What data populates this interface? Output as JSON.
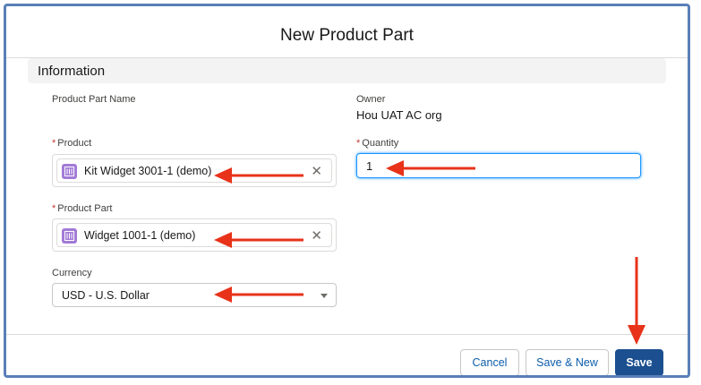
{
  "modal": {
    "title": "New Product Part"
  },
  "section": {
    "title": "Information"
  },
  "fields": {
    "product_part_name": {
      "label": "Product Part Name"
    },
    "owner": {
      "label": "Owner",
      "value": "Hou UAT AC org"
    },
    "product": {
      "label": "Product",
      "required_mark": "*",
      "value": "Kit Widget 3001-1 (demo)"
    },
    "quantity": {
      "label": "Quantity",
      "required_mark": "*",
      "value": "1"
    },
    "product_part": {
      "label": "Product Part",
      "required_mark": "*",
      "value": "Widget 1001-1 (demo)"
    },
    "currency": {
      "label": "Currency",
      "value": "USD - U.S. Dollar"
    }
  },
  "icons": {
    "record": "product-record-icon",
    "clear": "close-icon",
    "caret": "chevron-down-icon"
  },
  "buttons": {
    "cancel": "Cancel",
    "save_new": "Save & New",
    "save": "Save"
  },
  "colors": {
    "brand": "#1b4f8f",
    "annotation_arrow": "#e8321a",
    "focus": "#1b96ff",
    "record_icon": "#a27ad6",
    "required": "#c23934"
  }
}
